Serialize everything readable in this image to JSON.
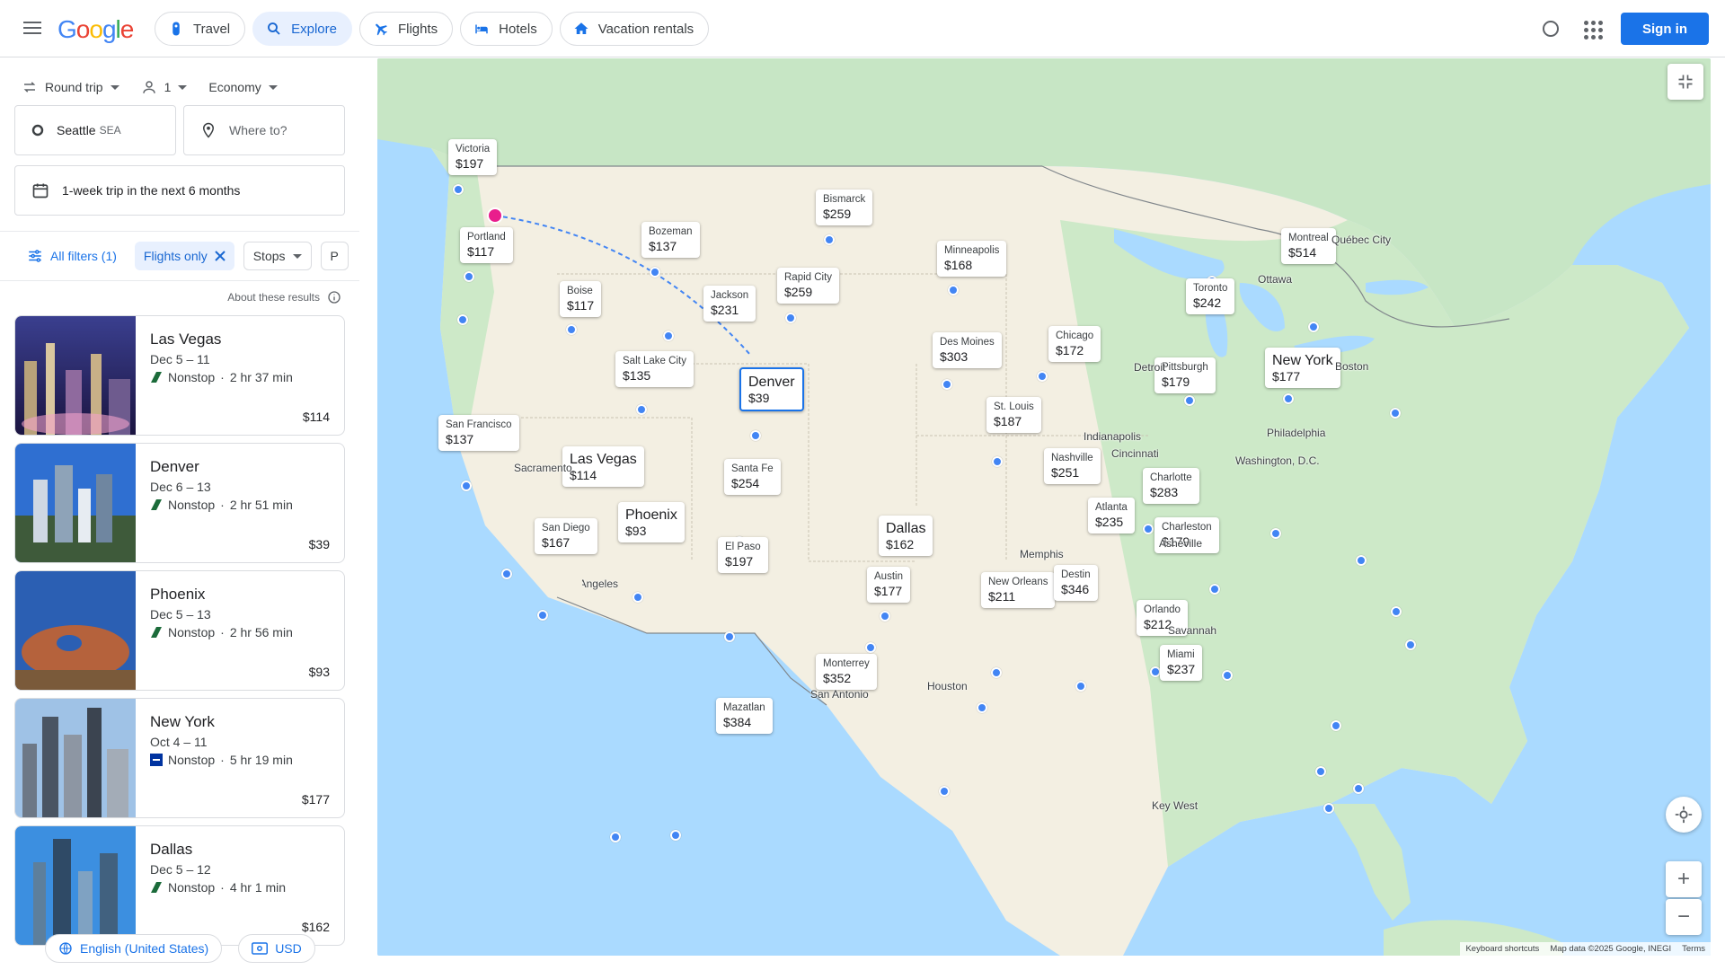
{
  "header": {
    "nav": [
      {
        "label": "Travel",
        "icon": "travel-tag-icon"
      },
      {
        "label": "Explore",
        "icon": "explore-icon",
        "active": true
      },
      {
        "label": "Flights",
        "icon": "flight-icon"
      },
      {
        "label": "Hotels",
        "icon": "hotel-bed-icon"
      },
      {
        "label": "Vacation rentals",
        "icon": "house-icon"
      }
    ],
    "sign_in": "Sign in"
  },
  "search": {
    "trip_type": "Round trip",
    "passengers": "1",
    "cabin": "Economy",
    "origin": "Seattle",
    "origin_code": "SEA",
    "destination_placeholder": "Where to?",
    "date_range": "1-week trip in the next 6 months"
  },
  "filters": {
    "all": "All filters (1)",
    "flights_only": "Flights only",
    "stops": "Stops",
    "more": "P"
  },
  "about": "About these results",
  "results": [
    {
      "city": "Las Vegas",
      "dates": "Dec 5 – 11",
      "stops": "Nonstop",
      "duration": "2 hr 37 min",
      "price": "$114"
    },
    {
      "city": "Denver",
      "dates": "Dec 6 – 13",
      "stops": "Nonstop",
      "duration": "2 hr 51 min",
      "price": "$39"
    },
    {
      "city": "Phoenix",
      "dates": "Dec 5 – 13",
      "stops": "Nonstop",
      "duration": "2 hr 56 min",
      "price": "$93"
    },
    {
      "city": "New York",
      "dates": "Oct 4 – 11",
      "stops": "Nonstop",
      "duration": "5 hr 19 min",
      "price": "$177"
    },
    {
      "city": "Dallas",
      "dates": "Dec 5 – 12",
      "stops": "Nonstop",
      "duration": "4 hr 1 min",
      "price": "$162"
    }
  ],
  "footer": {
    "language": "English (United States)",
    "currency": "USD"
  },
  "map": {
    "labels": [
      {
        "name": "Victoria",
        "price": "$197"
      },
      {
        "name": "Portland",
        "price": "$117"
      },
      {
        "name": "Bozeman",
        "price": "$137"
      },
      {
        "name": "Bismarck",
        "price": "$259"
      },
      {
        "name": "Boise",
        "price": "$117"
      },
      {
        "name": "Jackson",
        "price": "$231"
      },
      {
        "name": "Rapid City",
        "price": "$259"
      },
      {
        "name": "Minneapolis",
        "price": "$168"
      },
      {
        "name": "Montreal",
        "price": "$514"
      },
      {
        "name": "Toronto",
        "price": "$242"
      },
      {
        "name": "Chicago",
        "price": "$172"
      },
      {
        "name": "Des Moines",
        "price": "$303"
      },
      {
        "name": "Salt Lake City",
        "price": "$135"
      },
      {
        "name": "Denver",
        "price": "$39"
      },
      {
        "name": "New York",
        "price": "$177"
      },
      {
        "name": "Pittsburgh",
        "price": "$179"
      },
      {
        "name": "St. Louis",
        "price": "$187"
      },
      {
        "name": "San Francisco",
        "price": "$137"
      },
      {
        "name": "Las Vegas",
        "price": "$114"
      },
      {
        "name": "Santa Fe",
        "price": "$254"
      },
      {
        "name": "Nashville",
        "price": "$251"
      },
      {
        "name": "Charlotte",
        "price": "$283"
      },
      {
        "name": "Phoenix",
        "price": "$93"
      },
      {
        "name": "San Diego",
        "price": "$167"
      },
      {
        "name": "Dallas",
        "price": "$162"
      },
      {
        "name": "Atlanta",
        "price": "$235"
      },
      {
        "name": "Charleston",
        "price": "$179"
      },
      {
        "name": "El Paso",
        "price": "$197"
      },
      {
        "name": "Austin",
        "price": "$177"
      },
      {
        "name": "New Orleans",
        "price": "$211"
      },
      {
        "name": "Destin",
        "price": "$346"
      },
      {
        "name": "Orlando",
        "price": "$212"
      },
      {
        "name": "Miami",
        "price": "$237"
      },
      {
        "name": "Monterrey",
        "price": "$352"
      },
      {
        "name": "Mazatlan",
        "price": "$384"
      }
    ],
    "places": [
      "Québec City",
      "Ottawa",
      "Detroit",
      "Boston",
      "Philadelphia",
      "Washington, D.C.",
      "Indianapolis",
      "Cincinnati",
      "Sacramento",
      "Memphis",
      "Asheville",
      "Savannah",
      "Houston",
      "San Antonio",
      "Key West",
      "Los Angeles"
    ],
    "attribution": {
      "shortcuts": "Keyboard shortcuts",
      "data": "Map data ©2025 Google, INEGI",
      "terms": "Terms"
    },
    "colors": {
      "water": "#aadaff",
      "land_us": "#f1efe8",
      "land_green": "#bfe3c0",
      "route": "#4285f4",
      "origin_pin": "#e91e8c"
    }
  }
}
